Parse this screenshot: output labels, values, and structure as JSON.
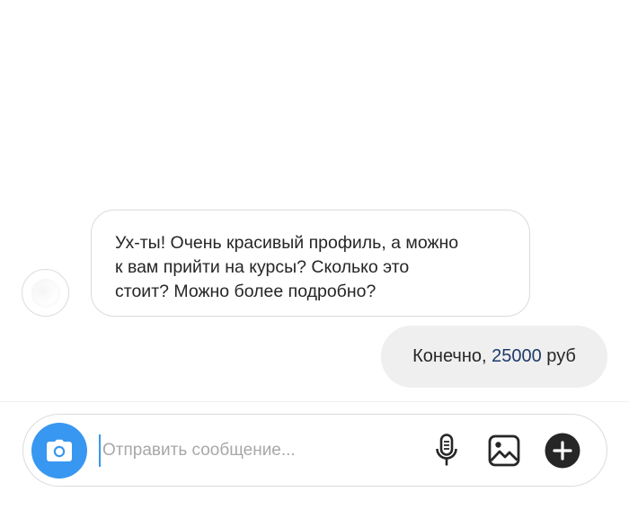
{
  "thread": {
    "received": {
      "lines": [
        "Ух-ты! Очень красивый профиль, а можно",
        "к вам прийти на курсы? Сколько это",
        "стоит? Можно более подробно?"
      ]
    },
    "sent": {
      "prefix": "Конечно, ",
      "amount": "25000",
      "suffix": " руб"
    }
  },
  "composer": {
    "placeholder": "Отправить сообщение...",
    "icons": {
      "camera": "camera-icon",
      "microphone": "microphone-icon",
      "gallery": "gallery-icon",
      "more": "plus-icon"
    },
    "accent_color": "#3897f0"
  }
}
